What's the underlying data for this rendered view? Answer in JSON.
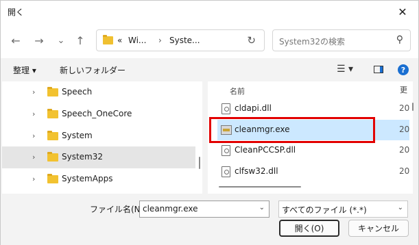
{
  "window": {
    "title": "開く",
    "close_glyph": "✕"
  },
  "nav": {
    "back_glyph": "←",
    "forward_glyph": "→",
    "recent_glyph": "⌄",
    "up_glyph": "↑",
    "address_prefix": "«",
    "crumbs": [
      "Wi...",
      "Syste..."
    ],
    "crumb_sep": "›",
    "refresh_glyph": "↻",
    "search_placeholder": "System32の検索",
    "search_glyph": "⚲"
  },
  "toolbar": {
    "organize_label": "整理 ▾",
    "new_folder_label": "新しいフォルダー",
    "view_glyph": "☰ ▾",
    "help_glyph": "?"
  },
  "tree": {
    "items": [
      {
        "label": "Speech",
        "selected": false
      },
      {
        "label": "Speech_OneCore",
        "selected": false
      },
      {
        "label": "System",
        "selected": false
      },
      {
        "label": "System32",
        "selected": true
      },
      {
        "label": "SystemApps",
        "selected": false
      }
    ],
    "chevron_glyph": "›"
  },
  "filelist": {
    "header_name": "名前",
    "header_date": "更",
    "sort_glyph": "⌃",
    "files": [
      {
        "name": "cldapi.dll",
        "date": "20",
        "kind": "dll",
        "selected": false
      },
      {
        "name": "cleanmgr.exe",
        "date": "20",
        "kind": "exe",
        "selected": true
      },
      {
        "name": "CleanPCCSP.dll",
        "date": "20",
        "kind": "dll",
        "selected": false
      },
      {
        "name": "clfsw32.dll",
        "date": "20",
        "kind": "dll",
        "selected": false
      }
    ]
  },
  "bottom": {
    "filename_label": "ファイル名(N):",
    "filename_value": "cleanmgr.exe",
    "filter_value": "すべてのファイル (*.*)",
    "dropdown_glyph": "⌄",
    "open_label": "開く(O)",
    "cancel_label": "キャンセル"
  },
  "colors": {
    "highlight_box": "#e20000",
    "selection": "#cce8ff",
    "accent": "#1a6fd1"
  }
}
